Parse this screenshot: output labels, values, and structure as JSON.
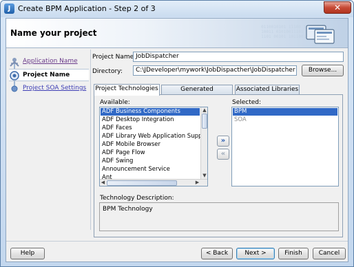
{
  "window": {
    "title": "Create BPM Application - Step 2 of 3",
    "close_symbol": "✕"
  },
  "header": {
    "title": "Name your project",
    "binary_text": "0110010101 11100 1011\n10011 01010011101 01\n1101 00101 1011001101"
  },
  "nav": {
    "items": [
      {
        "label": "Application Name",
        "state": "visited",
        "icon": "step-visited-icon"
      },
      {
        "label": "Project Name",
        "state": "current",
        "icon": "step-current-icon"
      },
      {
        "label": "Project SOA Settings",
        "state": "link",
        "icon": "step-next-icon"
      }
    ]
  },
  "form": {
    "project_name_label": "Project Name:",
    "project_name_value": "JobDispatcher",
    "directory_label": "Directory:",
    "directory_value": "C:\\JDeveloper\\mywork\\JobDispacther\\JobDispatcher",
    "browse_label": "Browse..."
  },
  "tabs": [
    {
      "label": "Project Technologies",
      "active": true
    },
    {
      "label": "Generated Components",
      "active": false
    },
    {
      "label": "Associated Libraries",
      "active": false
    }
  ],
  "technologies": {
    "available_label": "Available:",
    "available": [
      "ADF Business Components",
      "ADF Desktop Integration",
      "ADF Faces",
      "ADF Library Web Application Support",
      "ADF Mobile Browser",
      "ADF Page Flow",
      "ADF Swing",
      "Announcement Service",
      "Ant"
    ],
    "available_selected_index": 0,
    "selected_label": "Selected:",
    "selected": [
      {
        "label": "BPM",
        "selected": true,
        "disabled": false
      },
      {
        "label": "SOA",
        "selected": false,
        "disabled": true
      }
    ],
    "add_symbol": "»",
    "remove_symbol": "«",
    "description_label": "Technology Description:",
    "description": "BPM Technology"
  },
  "footer": {
    "help": "Help",
    "back": "< Back",
    "next": "Next >",
    "finish": "Finish",
    "cancel": "Cancel"
  },
  "colors": {
    "selection": "#3169c6",
    "link": "#3c3cb4",
    "close_button": "#c74a36"
  }
}
